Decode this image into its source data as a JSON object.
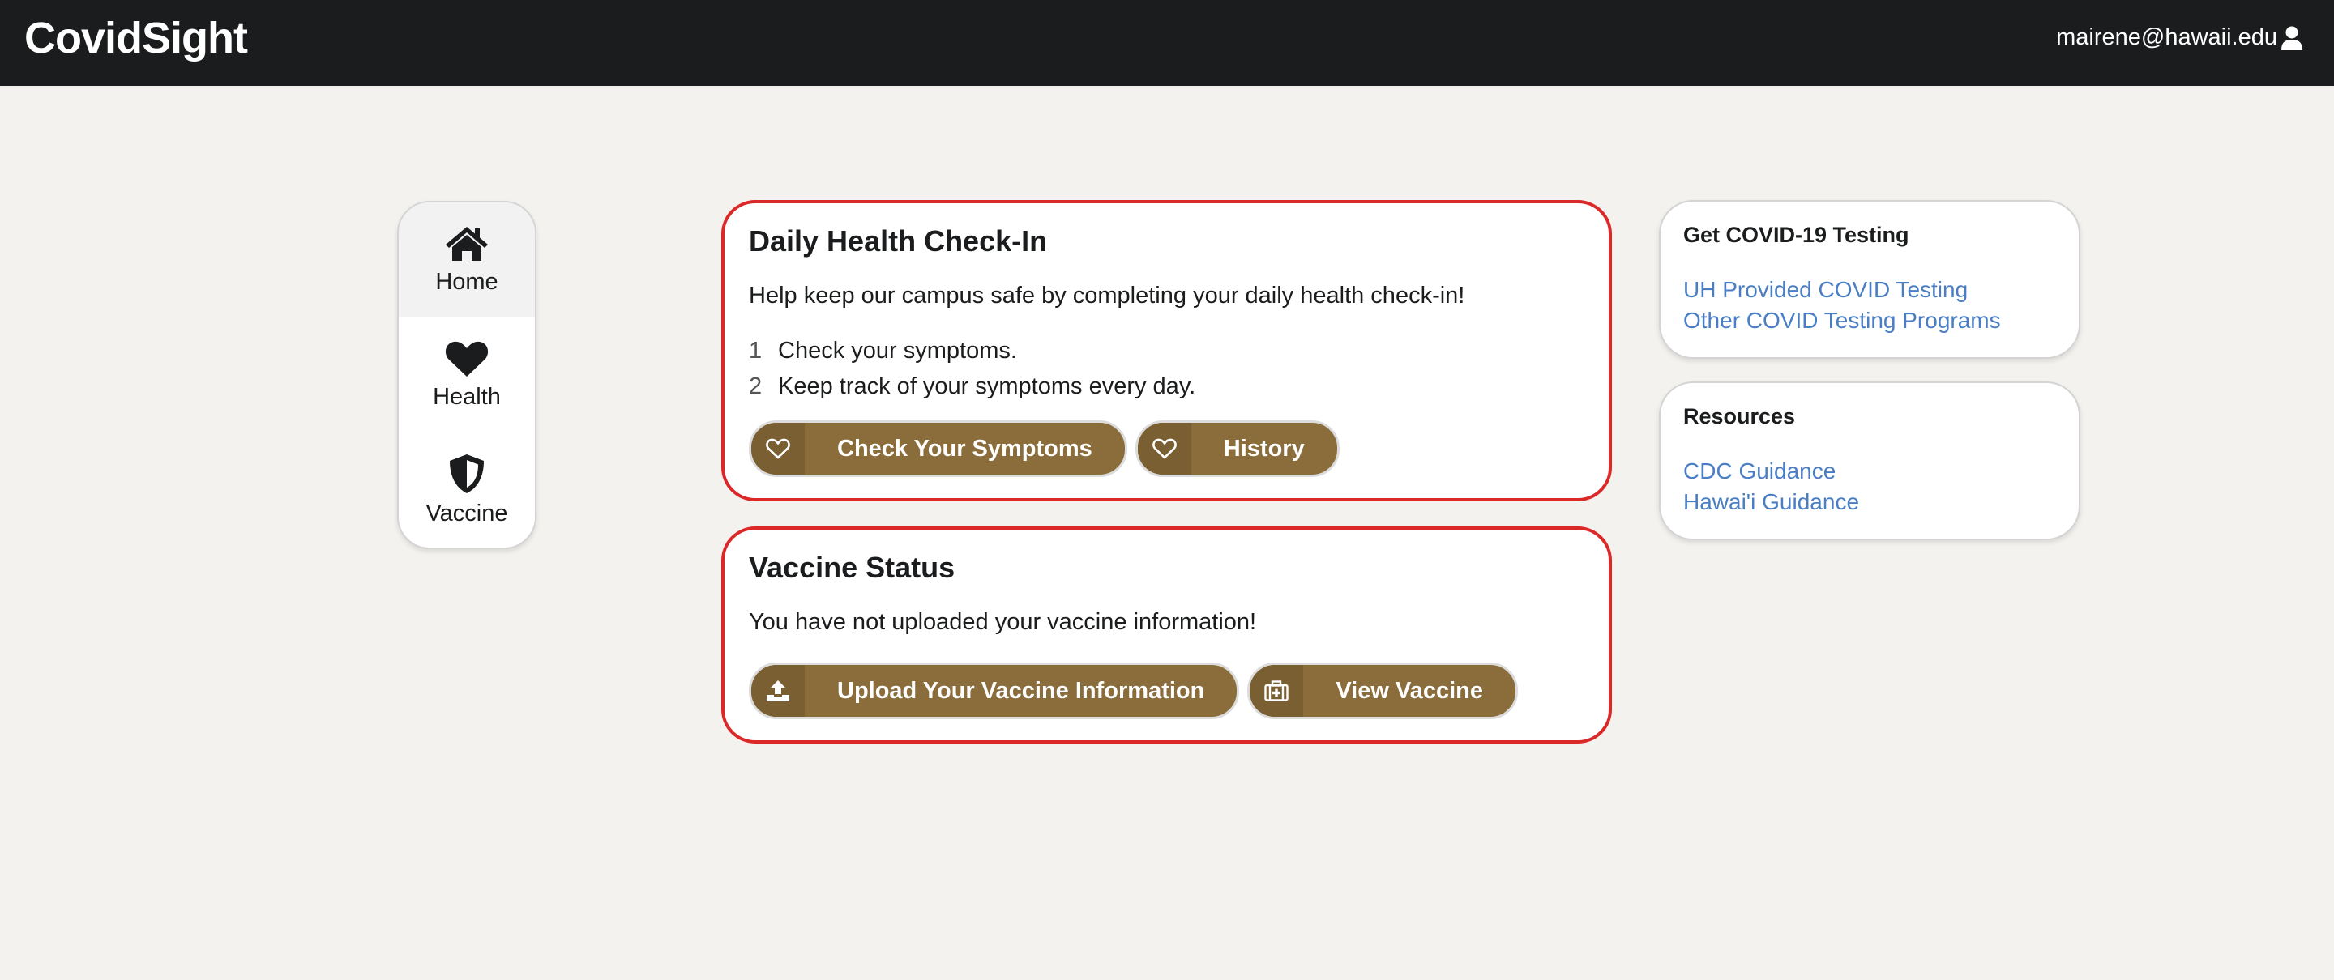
{
  "header": {
    "brand": "CovidSight",
    "user_email": "mairene@hawaii.edu",
    "user_icon": "user-icon"
  },
  "sidebar": {
    "items": [
      {
        "label": "Home",
        "icon": "home-icon",
        "active": true
      },
      {
        "label": "Health",
        "icon": "heart-icon",
        "active": false
      },
      {
        "label": "Vaccine",
        "icon": "shield-icon",
        "active": false
      }
    ]
  },
  "daily_checkin": {
    "title": "Daily Health Check-In",
    "description": "Help keep our campus safe by completing your daily health check-in!",
    "steps": [
      {
        "num": "1",
        "text": "Check your symptoms."
      },
      {
        "num": "2",
        "text": "Keep track of your symptoms every day."
      }
    ],
    "buttons": [
      {
        "label": "Check Your Symptoms",
        "icon": "heart-outline-icon"
      },
      {
        "label": "History",
        "icon": "heart-outline-icon"
      }
    ]
  },
  "vaccine_status": {
    "title": "Vaccine Status",
    "description": "You have not uploaded your vaccine information!",
    "buttons": [
      {
        "label": "Upload Your Vaccine Information",
        "icon": "upload-icon"
      },
      {
        "label": "View Vaccine",
        "icon": "medkit-icon"
      }
    ]
  },
  "testing": {
    "title": "Get COVID-19 Testing",
    "links": [
      "UH Provided COVID Testing",
      "Other COVID Testing Programs"
    ]
  },
  "resources": {
    "title": "Resources",
    "links": [
      "CDC Guidance",
      "Hawai'i Guidance"
    ]
  },
  "colors": {
    "header_bg": "#1b1c1d",
    "page_bg": "#f4f2ee",
    "card_border": "#db2828",
    "button_bg": "#8b6d3b",
    "link": "#4a7ec4"
  }
}
